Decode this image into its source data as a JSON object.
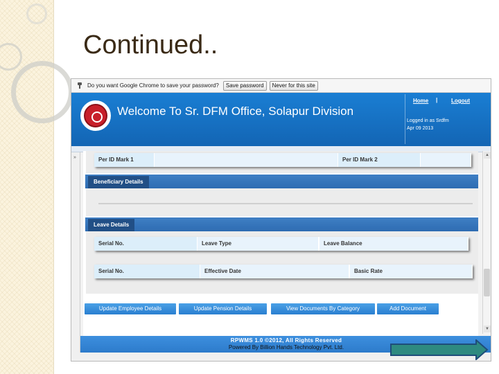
{
  "slide": {
    "title": "Continued.."
  },
  "browser": {
    "infobar": {
      "prompt": "Do you want Google Chrome to save your password?",
      "save_button": "Save password",
      "never_button": "Never for this site"
    }
  },
  "header": {
    "welcome": "Welcome To Sr. DFM Office, Solapur Division",
    "home_link": "Home",
    "separator": "|",
    "logout_link": "Logout",
    "logged_in": "Logged in as Srdfm",
    "date": "Apr 09 2013"
  },
  "form": {
    "per_id_mark_1": "Per ID Mark 1",
    "per_id_mark_2": "Per ID Mark 2",
    "beneficiary_section": "Beneficiary Details",
    "leave_section": "Leave Details",
    "leave_columns": [
      "Serial No.",
      "Leave Type",
      "Leave Balance"
    ],
    "rate_columns": [
      "Serial No.",
      "Effective Date",
      "Basic Rate"
    ]
  },
  "actions": {
    "update_employee": "Update Employee Details",
    "update_pension": "Update Pension Details",
    "view_documents": "View Documents By Category",
    "add_document": "Add Document"
  },
  "footer": {
    "line1": "RPWMS 1.0 ©2012, All Rights Reserved",
    "line2": "Powered By Billion Hands Technology Pvt. Ltd."
  },
  "icons": {
    "pin": "pin-icon",
    "logo": "railway-logo-icon",
    "next": "right-arrow-icon"
  },
  "colors": {
    "header_blue": "#1a7ed3",
    "section_blue": "#2e6cb2",
    "button_blue": "#2a7fd0",
    "arrow_teal": "#2e8a80"
  }
}
